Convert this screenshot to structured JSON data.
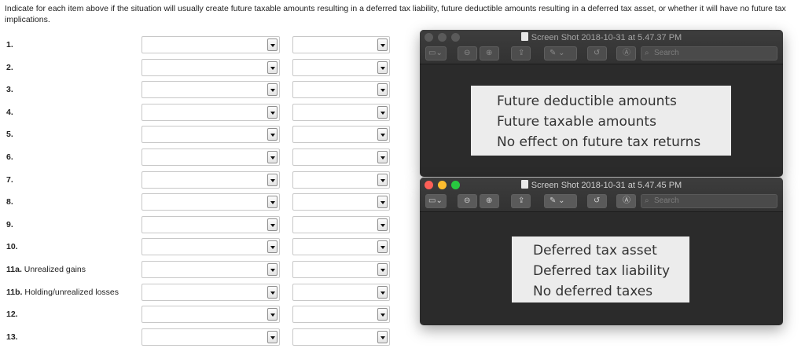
{
  "instructions": "Indicate for each item above if the situation will usually create future taxable amounts resulting in a deferred tax liability, future deductible amounts resulting in a deferred tax asset, or whether it will have no future tax implications.",
  "questions": [
    {
      "num": "1.",
      "text": ""
    },
    {
      "num": "2.",
      "text": ""
    },
    {
      "num": "3.",
      "text": ""
    },
    {
      "num": "4.",
      "text": ""
    },
    {
      "num": "5.",
      "text": ""
    },
    {
      "num": "6.",
      "text": ""
    },
    {
      "num": "7.",
      "text": ""
    },
    {
      "num": "8.",
      "text": ""
    },
    {
      "num": "9.",
      "text": ""
    },
    {
      "num": "10.",
      "text": ""
    },
    {
      "num": "11a.",
      "text": "Unrealized gains"
    },
    {
      "num": "11b.",
      "text": "Holding/unrealized losses"
    },
    {
      "num": "12.",
      "text": ""
    },
    {
      "num": "13.",
      "text": ""
    }
  ],
  "dropdown_selected_1": "",
  "dropdown_selected_2": "",
  "window_top": {
    "title": "Screen Shot 2018-10-31 at 5.47.37 PM",
    "search_placeholder": "Search",
    "options": [
      "Future deductible amounts",
      "Future taxable amounts",
      "No effect on future tax returns"
    ]
  },
  "window_bottom": {
    "title": "Screen Shot 2018-10-31 at 5.47.45 PM",
    "search_placeholder": "Search",
    "options": [
      "Deferred tax asset",
      "Deferred tax liability",
      "No deferred taxes"
    ]
  },
  "icons": {
    "sidebar": "sidebar-icon",
    "zoom_out": "zoom-out-icon",
    "zoom_in": "zoom-in-icon",
    "share": "share-icon",
    "markup": "pen-icon",
    "rotate": "rotate-icon",
    "annotate": "markup-circle-icon",
    "search": "search-icon"
  },
  "colors": {
    "window_bg": "#2b2b2b",
    "panel_bg": "#ececec",
    "close": "#fc5f57",
    "minimize": "#fdbc2e",
    "zoom": "#28c840"
  }
}
